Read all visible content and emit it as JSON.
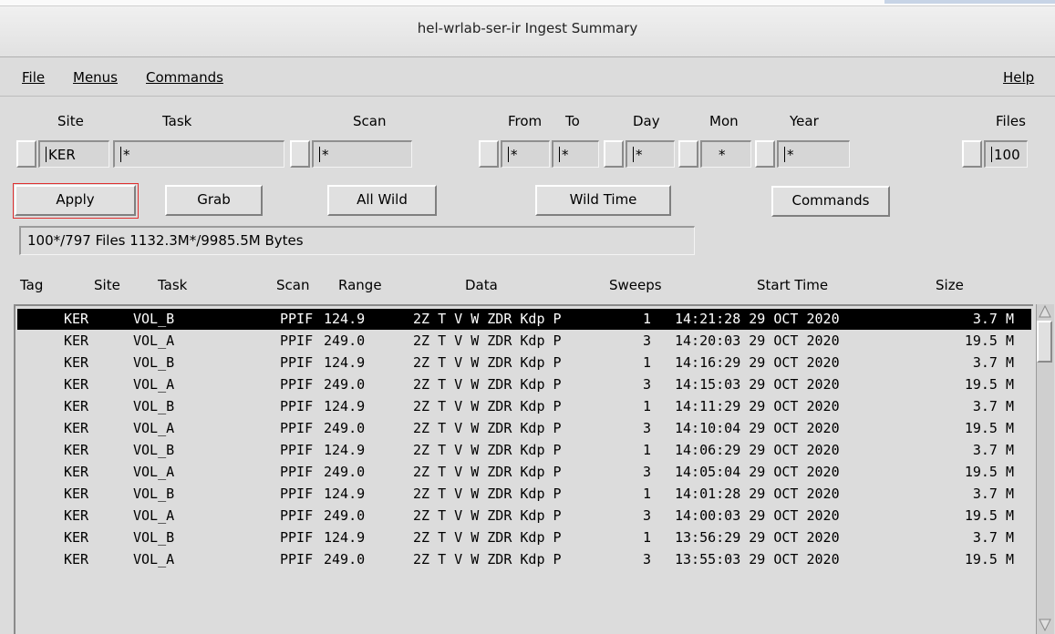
{
  "window": {
    "title": "hel-wrlab-ser-ir  Ingest Summary"
  },
  "menubar": {
    "file": "File",
    "menus": "Menus",
    "commands": "Commands",
    "help": "Help"
  },
  "filters": {
    "labels": {
      "site": "Site",
      "task": "Task",
      "scan": "Scan",
      "from": "From",
      "to": "To",
      "day": "Day",
      "mon": "Mon",
      "year": "Year",
      "files": "Files"
    },
    "values": {
      "site": "KER",
      "task": "*",
      "scan": "*",
      "from": "*",
      "to": "*",
      "day": "*",
      "mon": "*",
      "year": "*",
      "files": "100"
    }
  },
  "buttons": {
    "apply": "Apply",
    "grab": "Grab",
    "all_wild": "All Wild",
    "wild_time": "Wild Time",
    "commands": "Commands"
  },
  "status": "100*/797 Files  1132.3M*/9985.5M Bytes",
  "columns": {
    "tag": "Tag",
    "site": "Site",
    "task": "Task",
    "scan": "Scan",
    "range": "Range",
    "data": "Data",
    "sweeps": "Sweeps",
    "start_time": "Start Time",
    "size": "Size"
  },
  "rows": [
    {
      "site": "KER",
      "task": "VOL_B",
      "scan": "PPIF",
      "range": "124.9",
      "data": "2Z T V W ZDR Kdp P",
      "sweeps": "1",
      "start_time": "14:21:28 29 OCT 2020",
      "size": "3.7 M",
      "selected": true
    },
    {
      "site": "KER",
      "task": "VOL_A",
      "scan": "PPIF",
      "range": "249.0",
      "data": "2Z T V W ZDR Kdp P",
      "sweeps": "3",
      "start_time": "14:20:03 29 OCT 2020",
      "size": "19.5 M"
    },
    {
      "site": "KER",
      "task": "VOL_B",
      "scan": "PPIF",
      "range": "124.9",
      "data": "2Z T V W ZDR Kdp P",
      "sweeps": "1",
      "start_time": "14:16:29 29 OCT 2020",
      "size": "3.7 M"
    },
    {
      "site": "KER",
      "task": "VOL_A",
      "scan": "PPIF",
      "range": "249.0",
      "data": "2Z T V W ZDR Kdp P",
      "sweeps": "3",
      "start_time": "14:15:03 29 OCT 2020",
      "size": "19.5 M"
    },
    {
      "site": "KER",
      "task": "VOL_B",
      "scan": "PPIF",
      "range": "124.9",
      "data": "2Z T V W ZDR Kdp P",
      "sweeps": "1",
      "start_time": "14:11:29 29 OCT 2020",
      "size": "3.7 M"
    },
    {
      "site": "KER",
      "task": "VOL_A",
      "scan": "PPIF",
      "range": "249.0",
      "data": "2Z T V W ZDR Kdp P",
      "sweeps": "3",
      "start_time": "14:10:04 29 OCT 2020",
      "size": "19.5 M"
    },
    {
      "site": "KER",
      "task": "VOL_B",
      "scan": "PPIF",
      "range": "124.9",
      "data": "2Z T V W ZDR Kdp P",
      "sweeps": "1",
      "start_time": "14:06:29 29 OCT 2020",
      "size": "3.7 M"
    },
    {
      "site": "KER",
      "task": "VOL_A",
      "scan": "PPIF",
      "range": "249.0",
      "data": "2Z T V W ZDR Kdp P",
      "sweeps": "3",
      "start_time": "14:05:04 29 OCT 2020",
      "size": "19.5 M"
    },
    {
      "site": "KER",
      "task": "VOL_B",
      "scan": "PPIF",
      "range": "124.9",
      "data": "2Z T V W ZDR Kdp P",
      "sweeps": "1",
      "start_time": "14:01:28 29 OCT 2020",
      "size": "3.7 M"
    },
    {
      "site": "KER",
      "task": "VOL_A",
      "scan": "PPIF",
      "range": "249.0",
      "data": "2Z T V W ZDR Kdp P",
      "sweeps": "3",
      "start_time": "14:00:03 29 OCT 2020",
      "size": "19.5 M"
    },
    {
      "site": "KER",
      "task": "VOL_B",
      "scan": "PPIF",
      "range": "124.9",
      "data": "2Z T V W ZDR Kdp P",
      "sweeps": "1",
      "start_time": "13:56:29 29 OCT 2020",
      "size": "3.7 M"
    },
    {
      "site": "KER",
      "task": "VOL_A",
      "scan": "PPIF",
      "range": "249.0",
      "data": "2Z T V W ZDR Kdp P",
      "sweeps": "3",
      "start_time": "13:55:03 29 OCT 2020",
      "size": "19.5 M"
    }
  ],
  "icons": {
    "scroll_up": "scroll-up-arrow-icon",
    "scroll_down": "scroll-down-arrow-icon"
  },
  "colors": {
    "selected_row_bg": "#000000",
    "selected_row_fg": "#ffffff",
    "apply_focus": "#e03030"
  }
}
